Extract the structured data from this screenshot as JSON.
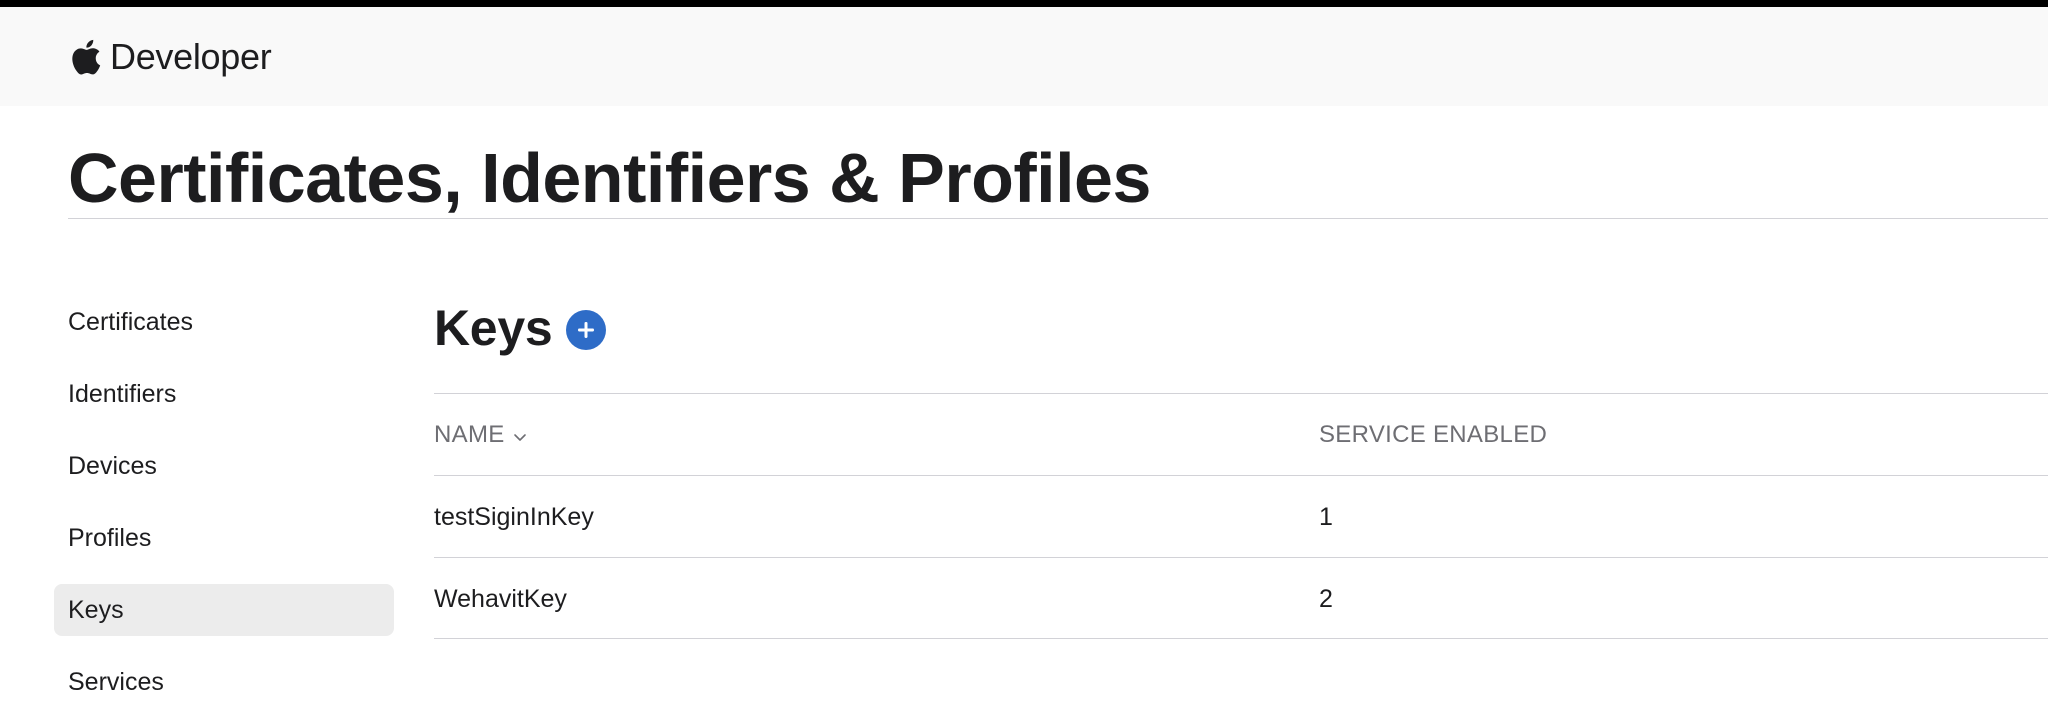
{
  "nav": {
    "brand_label": "Developer",
    "logo_icon": "apple-logo-icon"
  },
  "page": {
    "title": "Certificates, Identifiers & Profiles"
  },
  "sidebar": {
    "items": [
      {
        "label": "Certificates",
        "active": false
      },
      {
        "label": "Identifiers",
        "active": false
      },
      {
        "label": "Devices",
        "active": false
      },
      {
        "label": "Profiles",
        "active": false
      },
      {
        "label": "Keys",
        "active": true
      },
      {
        "label": "Services",
        "active": false
      }
    ]
  },
  "main": {
    "section_title": "Keys",
    "add_icon": "plus-circle-icon",
    "accent_color": "#2e6cc7",
    "table": {
      "columns": [
        "NAME",
        "SERVICE ENABLED"
      ],
      "sort_icon": "chevron-down-icon",
      "rows": [
        {
          "name": "testSiginInKey",
          "services": "1"
        },
        {
          "name": "WehavitKey",
          "services": "2"
        }
      ]
    }
  }
}
